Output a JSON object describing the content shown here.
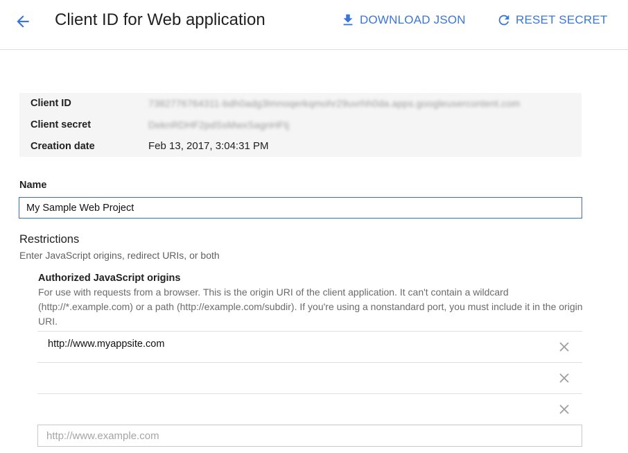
{
  "header": {
    "title": "Client ID for Web application",
    "download_label": "DOWNLOAD JSON",
    "reset_label": "RESET SECRET",
    "accent_color": "#3a76d6"
  },
  "info": {
    "rows": [
      {
        "label": "Client ID",
        "value": "7382776764311-bdh0adg3lmnoqerkqmohr29uvrhh0da.apps.googleusercontent.com",
        "obscured": true
      },
      {
        "label": "Client secret",
        "value": "DeknRDHF2pdSsMwxSagnHFtj",
        "obscured": true
      },
      {
        "label": "Creation date",
        "value": "Feb 13, 2017, 3:04:31 PM",
        "obscured": false
      }
    ]
  },
  "name": {
    "label": "Name",
    "value": "My Sample Web Project"
  },
  "restrictions": {
    "title": "Restrictions",
    "subtitle": "Enter JavaScript origins, redirect URIs, or both"
  },
  "origins": {
    "title": "Authorized JavaScript origins",
    "description": "For use with requests from a browser. This is the origin URI of the client application. It can't contain a wildcard (http://*.example.com) or a path (http://example.com/subdir). If you're using a nonstandard port, you must include it in the origin URI.",
    "items": [
      {
        "value": "http://www.myappsite.com"
      },
      {
        "value": ""
      },
      {
        "value": ""
      }
    ],
    "new_placeholder": "http://www.example.com",
    "icons": {
      "back": "arrow-back-icon",
      "download": "download-icon",
      "reset": "refresh-icon",
      "remove": "close-icon"
    }
  }
}
